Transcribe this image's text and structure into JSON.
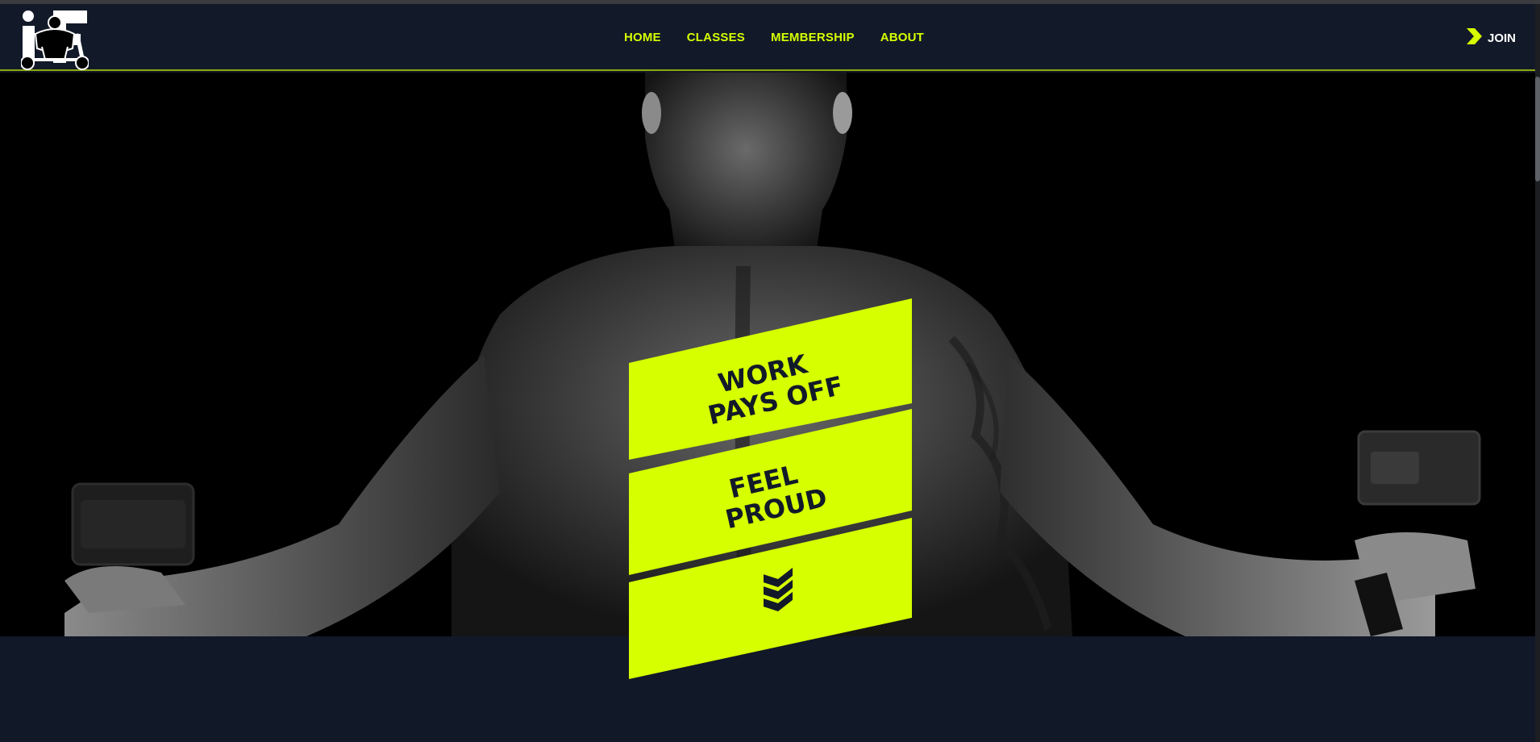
{
  "nav": {
    "links": [
      "HOME",
      "CLASSES",
      "MEMBERSHIP",
      "ABOUT"
    ],
    "join_label": "JOIN"
  },
  "banner": {
    "line1": "WORK",
    "line2": "PAYS OFF",
    "line3": "FEEL",
    "line4": "PROUD"
  },
  "colors": {
    "accent": "#d6ff00",
    "navy": "#121a29",
    "hero_bg": "#000000"
  },
  "icons": {
    "logo": "bodybuilder-logo",
    "join": "chevron-right-icon",
    "scroll": "triple-chevron-down-icon"
  }
}
